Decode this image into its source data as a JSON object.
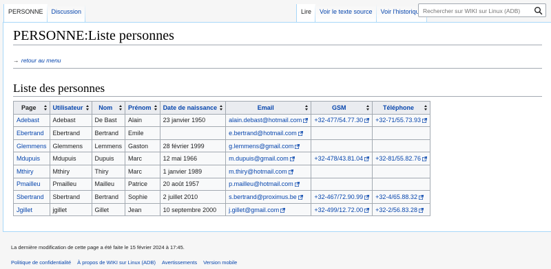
{
  "tabs": {
    "left": [
      {
        "label": "PERSONNE",
        "selected": true
      },
      {
        "label": "Discussion",
        "selected": false
      }
    ],
    "right": [
      {
        "label": "Lire",
        "selected": true
      },
      {
        "label": "Voir le texte source",
        "selected": false
      },
      {
        "label": "Voir l’historique",
        "selected": false
      }
    ]
  },
  "search": {
    "placeholder": "Rechercher sur WIKI sur Linux (ADB)",
    "icon": "search-icon"
  },
  "page": {
    "title": "PERSONNE:Liste personnes",
    "back_arrow": "→",
    "back_link": "retour au menu",
    "section_heading": "Liste des personnes"
  },
  "table": {
    "headers": [
      "Page",
      "Utilisateur",
      "Nom",
      "Prénom",
      "Date de naissance",
      "Email",
      "GSM",
      "Téléphone"
    ],
    "rows": [
      {
        "page": "Adebast",
        "user": "Adebast",
        "nom": "De Bast",
        "prenom": "Alain",
        "naissance": "23 janvier 1950",
        "email": "alain.debast@hotmail.com",
        "gsm": "+32-477/54.77.30",
        "tel": "+32-71/55.73.93"
      },
      {
        "page": "Ebertrand",
        "user": "Ebertrand",
        "nom": "Bertrand",
        "prenom": "Emile",
        "naissance": "",
        "email": "e.bertrand@hotmail.com",
        "gsm": "",
        "tel": ""
      },
      {
        "page": "Glemmens",
        "user": "Glemmens",
        "nom": "Lemmens",
        "prenom": "Gaston",
        "naissance": "28 février 1999",
        "email": "g.lemmens@gmail.com",
        "gsm": "",
        "tel": ""
      },
      {
        "page": "Mdupuis",
        "user": "Mdupuis",
        "nom": "Dupuis",
        "prenom": "Marc",
        "naissance": "12 mai 1966",
        "email": "m.dupuis@gmail.com",
        "gsm": "+32-478/43.81.04",
        "tel": "+32-81/55.82.76"
      },
      {
        "page": "Mthiry",
        "user": "Mthiry",
        "nom": "Thiry",
        "prenom": "Marc",
        "naissance": "1 janvier 1989",
        "email": "m.thiry@hotmail.com",
        "gsm": "",
        "tel": ""
      },
      {
        "page": "Pmailleu",
        "user": "Pmailleu",
        "nom": "Mailleu",
        "prenom": "Patrice",
        "naissance": "20 août 1957",
        "email": "p.mailleu@hotmail.com",
        "gsm": "",
        "tel": ""
      },
      {
        "page": "Sbertrand",
        "user": "Sbertrand",
        "nom": "Bertrand",
        "prenom": "Sophie",
        "naissance": "2 juillet 2010",
        "email": "s.bertrand@proximus.be",
        "gsm": "+32-467/72.90.99",
        "tel": "+32-4/65.88.32"
      },
      {
        "page": "Jgillet",
        "user": "jgillet",
        "nom": "Gillet",
        "prenom": "Jean",
        "naissance": "10 septembre 2000",
        "email": "j.gillet@gmail.com",
        "gsm": "+32-499/12.72.00",
        "tel": "+32-2/56.83.28"
      }
    ]
  },
  "footer": {
    "last_modified": "La dernière modification de cette page a été faite le 15 février 2024 à 17:45.",
    "links": [
      "Politique de confidentialité",
      "À propos de WIKI sur Linux (ADB)",
      "Avertissements",
      "Version mobile"
    ]
  },
  "colors": {
    "link": "#0645ad",
    "border": "#a2a9b1",
    "header_bg": "#eaecf0",
    "tab_border": "#a7d7f9"
  }
}
